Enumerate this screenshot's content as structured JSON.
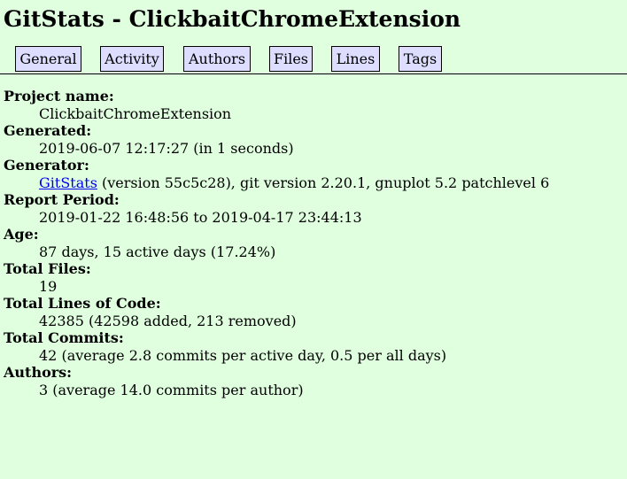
{
  "page": {
    "title": "GitStats - ClickbaitChromeExtension"
  },
  "nav": {
    "tabs": [
      "General",
      "Activity",
      "Authors",
      "Files",
      "Lines",
      "Tags"
    ]
  },
  "info": {
    "project_name_label": "Project name:",
    "project_name": "ClickbaitChromeExtension",
    "generated_label": "Generated:",
    "generated": "2019-06-07 12:17:27 (in 1 seconds)",
    "generator_label": "Generator:",
    "generator_link": "GitStats",
    "generator_rest": " (version 55c5c28), git version 2.20.1, gnuplot 5.2 patchlevel 6",
    "report_period_label": "Report Period:",
    "report_period": "2019-01-22 16:48:56 to 2019-04-17 23:44:13",
    "age_label": "Age:",
    "age": "87 days, 15 active days (17.24%)",
    "total_files_label": "Total Files:",
    "total_files": "19",
    "total_loc_label": "Total Lines of Code:",
    "total_loc": "42385 (42598 added, 213 removed)",
    "total_commits_label": "Total Commits:",
    "total_commits": "42 (average 2.8 commits per active day, 0.5 per all days)",
    "authors_label": "Authors:",
    "authors": "3 (average 14.0 commits per author)"
  }
}
